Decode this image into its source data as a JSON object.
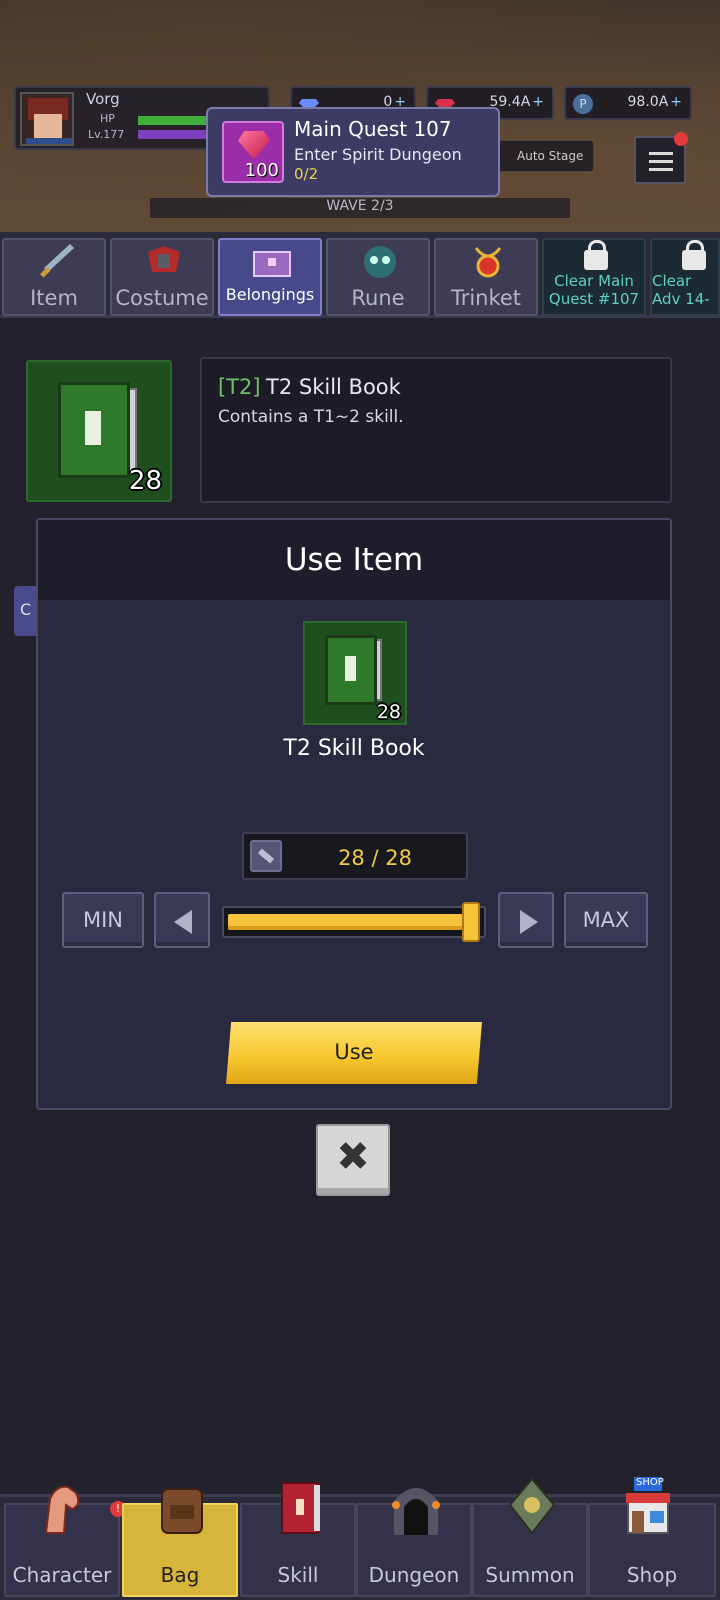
{
  "player": {
    "name": "Vorg",
    "hp_label": "HP",
    "level": "Lv.177",
    "hp_fill": 1.0,
    "xp_fill": 0.6
  },
  "currencies": [
    {
      "icon": "gem-icon",
      "value": "0"
    },
    {
      "icon": "ruby-icon",
      "value": "59.4A"
    },
    {
      "icon": "gold-coin-icon",
      "value": "98.0A"
    }
  ],
  "quest": {
    "title": "Main Quest 107",
    "reward_count": "100",
    "description": "Enter Spirit Dungeon",
    "progress": "0/2"
  },
  "auto_stage": "Auto Stage",
  "wave": "WAVE 2/3",
  "tabs": [
    {
      "label": "Item",
      "icon": "sword-icon"
    },
    {
      "label": "Costume",
      "icon": "armor-icon"
    },
    {
      "label": "Belongings",
      "icon": "treasure-chest-icon",
      "active": true
    },
    {
      "label": "Rune",
      "icon": "rune-icon"
    },
    {
      "label": "Trinket",
      "icon": "amulet-icon"
    },
    {
      "label": "Clear Main Quest #107",
      "icon": "lock-icon",
      "locked": true
    },
    {
      "label": "Clear Adv 14-",
      "icon": "lock-icon",
      "locked": true
    }
  ],
  "selected_item": {
    "tier_tag": "[T2]",
    "name": "T2 Skill Book",
    "description": "Contains a T1~2 skill.",
    "count": "28",
    "icon": "skill-book-icon"
  },
  "side_button": "C",
  "modal": {
    "title": "Use Item",
    "item_name": "T2 Skill Book",
    "item_count": "28",
    "quantity": "28 / 28",
    "slider_fraction": 1.0,
    "min_label": "MIN",
    "max_label": "MAX",
    "use_label": "Use",
    "close_icon": "close-icon"
  },
  "bottom_nav": [
    {
      "label": "Character",
      "icon": "muscle-arm-icon",
      "alert": "!"
    },
    {
      "label": "Bag",
      "icon": "backpack-icon",
      "active": true
    },
    {
      "label": "Skill",
      "icon": "skill-book-icon"
    },
    {
      "label": "Dungeon",
      "icon": "dungeon-gate-icon"
    },
    {
      "label": "Summon",
      "icon": "summon-icon"
    },
    {
      "label": "Shop",
      "icon": "shop-icon",
      "badge": "SHOP"
    }
  ],
  "colors": {
    "accent": "#f5c43a",
    "tier_green": "#6fc06a",
    "locked_text": "#5fd0c5",
    "panel": "#292940"
  }
}
